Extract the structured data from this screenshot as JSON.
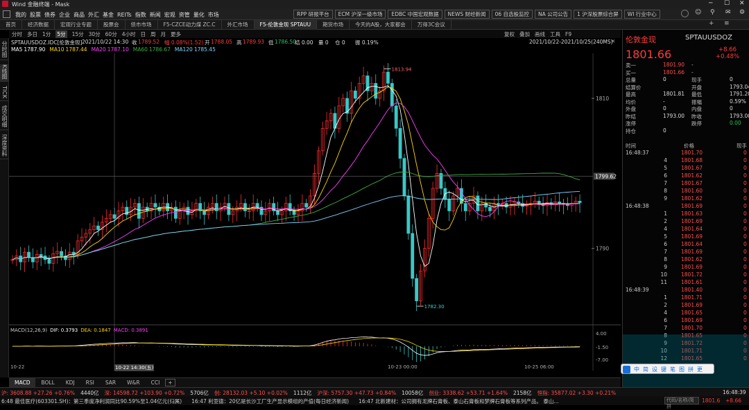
{
  "window": {
    "title": "Wind 金融终端 - Mask",
    "controls": [
      "minimize",
      "maximize",
      "close"
    ]
  },
  "menu": [
    "我的",
    "股票",
    "债券",
    "企业",
    "商品",
    "外汇",
    "基金",
    "REITs",
    "指数",
    "新闻",
    "宏观",
    "资管",
    "量化",
    "市场"
  ],
  "quick_buttons": [
    "RPP 研报平台",
    "ECM 沪深一级市场",
    "EDBC 中国宏观数据",
    "NEWS 财经新闻",
    "06 自选股监控",
    "NA 公司公告",
    "1 沪深股票综合屏",
    "WI 行业中心"
  ],
  "tabs": [
    "首页",
    "经济数据",
    "宏观行业专题",
    "股票会",
    "债市市场",
    "F5-CZCE动力煤 ZC.C",
    "外汇市场",
    "F5-伦敦金现 SPTAUU",
    "期货市场",
    "今天的A股，大家都会",
    "万得3C会议"
  ],
  "active_tab": 7,
  "periods": [
    "分时",
    "多日",
    "1分",
    "5分",
    "15分",
    "30分",
    "60分",
    "4小时",
    "日",
    "周",
    "月",
    "更多"
  ],
  "active_period": 3,
  "chart_tools": [
    "复权",
    "叠加",
    "画线",
    "工具",
    "F9"
  ],
  "info": {
    "symbol": "SPTAUUSDOZ.IDC[伦敦金现]",
    "datetime": "2021/10/22 14:30",
    "close_label": "收",
    "close": "1789.52",
    "chg": "幅 0.08%(1.52)",
    "open_label": "开",
    "open": "1788.05",
    "high_label": "高",
    "high": "1789.93",
    "low_label": "低",
    "low": "1786.50",
    "settle": "结 0.00",
    "amount": "量 0",
    "pos": "仓 0",
    "zhen": "振 0.19%",
    "range": "2021/10/22-2021/10/25(240MS)"
  },
  "ma": [
    {
      "label": "MA5",
      "value": "1787.90",
      "color": "#ffffff"
    },
    {
      "label": "MA10",
      "value": "1787.44",
      "color": "#ffd700"
    },
    {
      "label": "MA20",
      "value": "1787.10",
      "color": "#ff40ff"
    },
    {
      "label": "MA60",
      "value": "1786.67",
      "color": "#3cb043"
    },
    {
      "label": "MA120",
      "value": "1785.45",
      "color": "#7fd4ff"
    }
  ],
  "left_vtabs": [
    "分时图",
    "K线图",
    "TICK",
    "成交明细",
    "深度资料"
  ],
  "chart_data": {
    "type": "candlestick",
    "x_ticks": [
      "10-22",
      "10-22 14:30(五)",
      "10-23 00:00",
      "10-25 06:00"
    ],
    "y_ticks": [
      1810,
      1790
    ],
    "high_label": "1813.94",
    "low_label": "1782.30",
    "crosshair_value": "1799.62",
    "closes": [
      1788.5,
      1789,
      1788.2,
      1789.5,
      1788.8,
      1788.2,
      1789.2,
      1789,
      1788.5,
      1788,
      1789.3,
      1789.6,
      1789,
      1788.5,
      1789.5,
      1789.2,
      1791,
      1791.5,
      1792,
      1792.5,
      1793,
      1792.5,
      1793.5,
      1794,
      1794.5,
      1794,
      1795,
      1795.5,
      1794.5,
      1795.5,
      1796,
      1794,
      1795.5,
      1795,
      1796,
      1795.5,
      1795,
      1796,
      1795,
      1795.5,
      1794,
      1795,
      1795.5,
      1794.5,
      1795,
      1796,
      1795,
      1794.5,
      1795.5,
      1796,
      1795,
      1795.5,
      1796,
      1794.5,
      1795,
      1795.5,
      1796,
      1795,
      1795,
      1796,
      1795.5,
      1794.5,
      1795,
      1796,
      1795,
      1794.5,
      1795,
      1796,
      1795,
      1794.5,
      1795,
      1796,
      1795.5,
      1797,
      1800,
      1803,
      1806,
      1807,
      1808,
      1806,
      1809,
      1810,
      1808,
      1811,
      1810,
      1812,
      1813,
      1811,
      1812,
      1810,
      1811,
      1813.5,
      1812,
      1809,
      1806,
      1802,
      1797,
      1792,
      1786,
      1783,
      1787,
      1790,
      1794,
      1798,
      1800,
      1798,
      1796.5,
      1795,
      1797,
      1798,
      1796,
      1795,
      1796,
      1797,
      1795,
      1796,
      1795.5,
      1795,
      1796,
      1795.8,
      1796,
      1795.5,
      1795.8,
      1796.2,
      1796,
      1795.6,
      1795.8,
      1796,
      1796.3,
      1796,
      1795.7,
      1796.1,
      1795.8,
      1796.2,
      1796,
      1795.9,
      1795.7,
      1796,
      1796.3,
      1796.1
    ],
    "macd": {
      "label": "MACD(12,26,9)",
      "dif": "DIF: 0.3793",
      "dea": "DEA: 0.1847",
      "macd": "MACD: 0.3891",
      "y_ticks": [
        "4.00",
        "-1.50",
        "-7.00"
      ]
    }
  },
  "indicator_tabs": [
    "MACD",
    "BOLL",
    "KDJ",
    "RSI",
    "SAR",
    "W&R",
    "CCI"
  ],
  "active_indicator": 0,
  "quote": {
    "name": "伦敦金现",
    "code": "SPTAUUSDOZ",
    "price": "1801.66",
    "chg": "+8.66",
    "pct": "+0.48%",
    "rows": [
      [
        "卖一",
        "1801.90",
        "-"
      ],
      [
        "买一",
        "1801.66",
        "-"
      ],
      [
        "总量",
        "0",
        "现手",
        "0"
      ],
      [
        "结算价",
        "",
        "开盘",
        "1793.04"
      ],
      [
        "最高",
        "1801.81",
        "最低",
        "1791.20"
      ],
      [
        "均价",
        "-",
        "振幅",
        "0.59%"
      ],
      [
        "外盘",
        "0",
        "内盘",
        "0"
      ],
      [
        "昨结",
        "1793.00",
        "昨收",
        "1793.00"
      ],
      [
        "涨停",
        "",
        "跌停",
        "0.00"
      ],
      [
        "持仓",
        "0",
        "",
        ""
      ]
    ],
    "tick_headers": [
      "时间",
      "价格",
      "现手"
    ],
    "ticks": [
      [
        "16:48:37",
        "1801.70",
        "0"
      ],
      [
        "4",
        "1801.68",
        "0"
      ],
      [
        "5",
        "1801.67",
        "0"
      ],
      [
        "6",
        "1801.62",
        "0"
      ],
      [
        "7",
        "1801.67",
        "0"
      ],
      [
        "8",
        "1801.60",
        "0"
      ],
      [
        "9",
        "1801.62",
        "0"
      ],
      [
        "16:48:38",
        "1801.69",
        "0"
      ],
      [
        "1",
        "1801.63",
        "0"
      ],
      [
        "2",
        "1801.69",
        "0"
      ],
      [
        "4",
        "1801.64",
        "0"
      ],
      [
        "5",
        "1801.69",
        "0"
      ],
      [
        "6",
        "1801.64",
        "0"
      ],
      [
        "7",
        "1801.69",
        "0"
      ],
      [
        "8",
        "1801.62",
        "0"
      ],
      [
        "9",
        "1801.69",
        "0"
      ],
      [
        "10",
        "1801.72",
        "0"
      ],
      [
        "11",
        "1801.61",
        "0"
      ],
      [
        "16:48:39",
        "1801.40",
        "0"
      ],
      [
        "1",
        "1801.71",
        "0"
      ],
      [
        "2",
        "1801.69",
        "0"
      ],
      [
        "4",
        "1801.65",
        "0"
      ],
      [
        "6",
        "1801.69",
        "0"
      ],
      [
        "7",
        "1801.70",
        "0"
      ],
      [
        "8",
        "1801.65",
        "0"
      ],
      [
        "9",
        "1801.72",
        "0"
      ],
      [
        "10",
        "1801.71",
        "0"
      ],
      [
        "12",
        "1801.65",
        "0"
      ]
    ]
  },
  "floating_toolbar": [
    "中",
    "简",
    "设",
    "键",
    "笔",
    "图",
    "拼",
    "更"
  ],
  "status": {
    "items": [
      "沪: 3608.88 +27.26 +0.76%",
      "4440亿",
      "深: 14598.72 +103.90 +0.72%",
      "5706亿",
      "创: 28132.03 +5.10 +0.02%",
      "1112亿",
      "沪深: 5757.30 +47.73 +0.84%",
      "10058亿",
      "创业: 3338.62 +53.71 +1.64%",
      "2158亿",
      "恒指: 35877.02 +3.30 +0.21%"
    ],
    "time": "16:48:39"
  },
  "news": {
    "items": [
      "6:48 最佳医疗(603301.SH)：第三季度净利润同比90.59%至1.04亿元(归属)",
      "16:47 利亚德：20亿是长沙工厂生产显示模组的产值(每日经济新闻)",
      "16:47 北新建材：公司拥有龙牌石膏板、泰山石膏板和梦牌石膏板等系列产品。 泰山..."
    ],
    "search_placeholder": "代码/名称/简拼",
    "price": "1801.6",
    "chg": "+8.66"
  }
}
